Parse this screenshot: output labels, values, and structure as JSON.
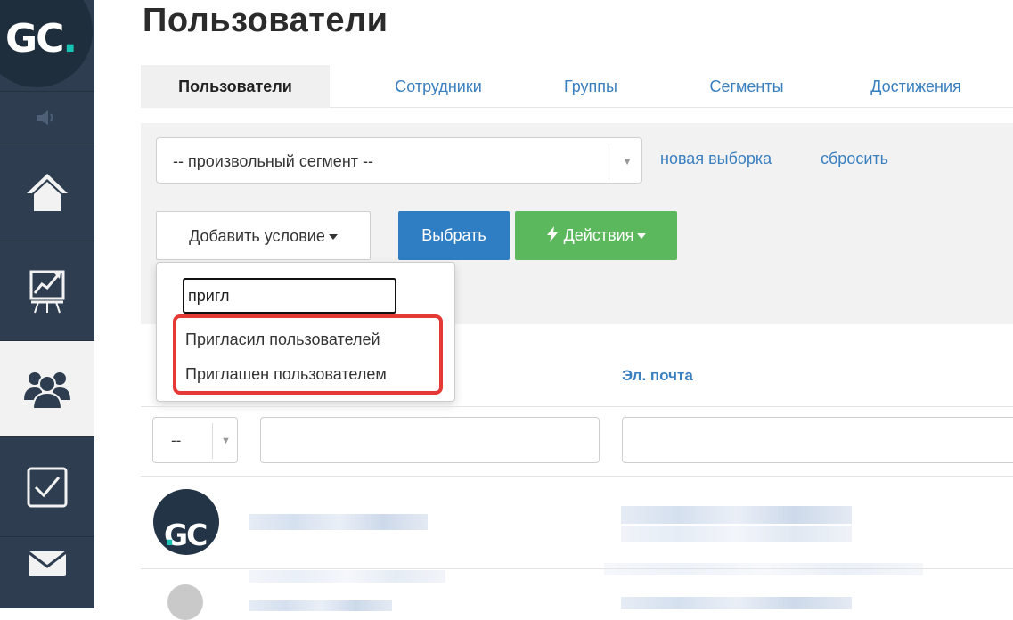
{
  "sidebar": {
    "logo_text": "GC",
    "logo_dot": ".",
    "items": [
      "sound-icon",
      "home-icon",
      "stats-icon",
      "users-icon",
      "tasks-icon",
      "mail-icon"
    ]
  },
  "page": {
    "title": "Пользователи"
  },
  "tabs": [
    {
      "label": "Пользователи",
      "active": true
    },
    {
      "label": "Сотрудники"
    },
    {
      "label": "Группы"
    },
    {
      "label": "Сегменты"
    },
    {
      "label": "Достижения"
    }
  ],
  "filter": {
    "segment_value": "-- произвольный сегмент --",
    "new_selection_link": "новая выборка",
    "reset_link": "сбросить",
    "add_condition_label": "Добавить условие",
    "select_button": "Выбрать",
    "actions_button": "Действия"
  },
  "condition_dropdown": {
    "search_value": "пригл",
    "options": [
      "Пригласил пользователей",
      "Приглашен пользователем"
    ]
  },
  "table": {
    "columns": [
      "Эл. почта"
    ],
    "filter_select_value": "--"
  },
  "avatar_text": "GC",
  "colors": {
    "sidebar": "#2e3e50",
    "accent_link": "#3a7fbf",
    "primary_button": "#2f7dc2",
    "success_button": "#5cb85c",
    "highlight": "#e53935",
    "logo_accent": "#19c3b4"
  }
}
